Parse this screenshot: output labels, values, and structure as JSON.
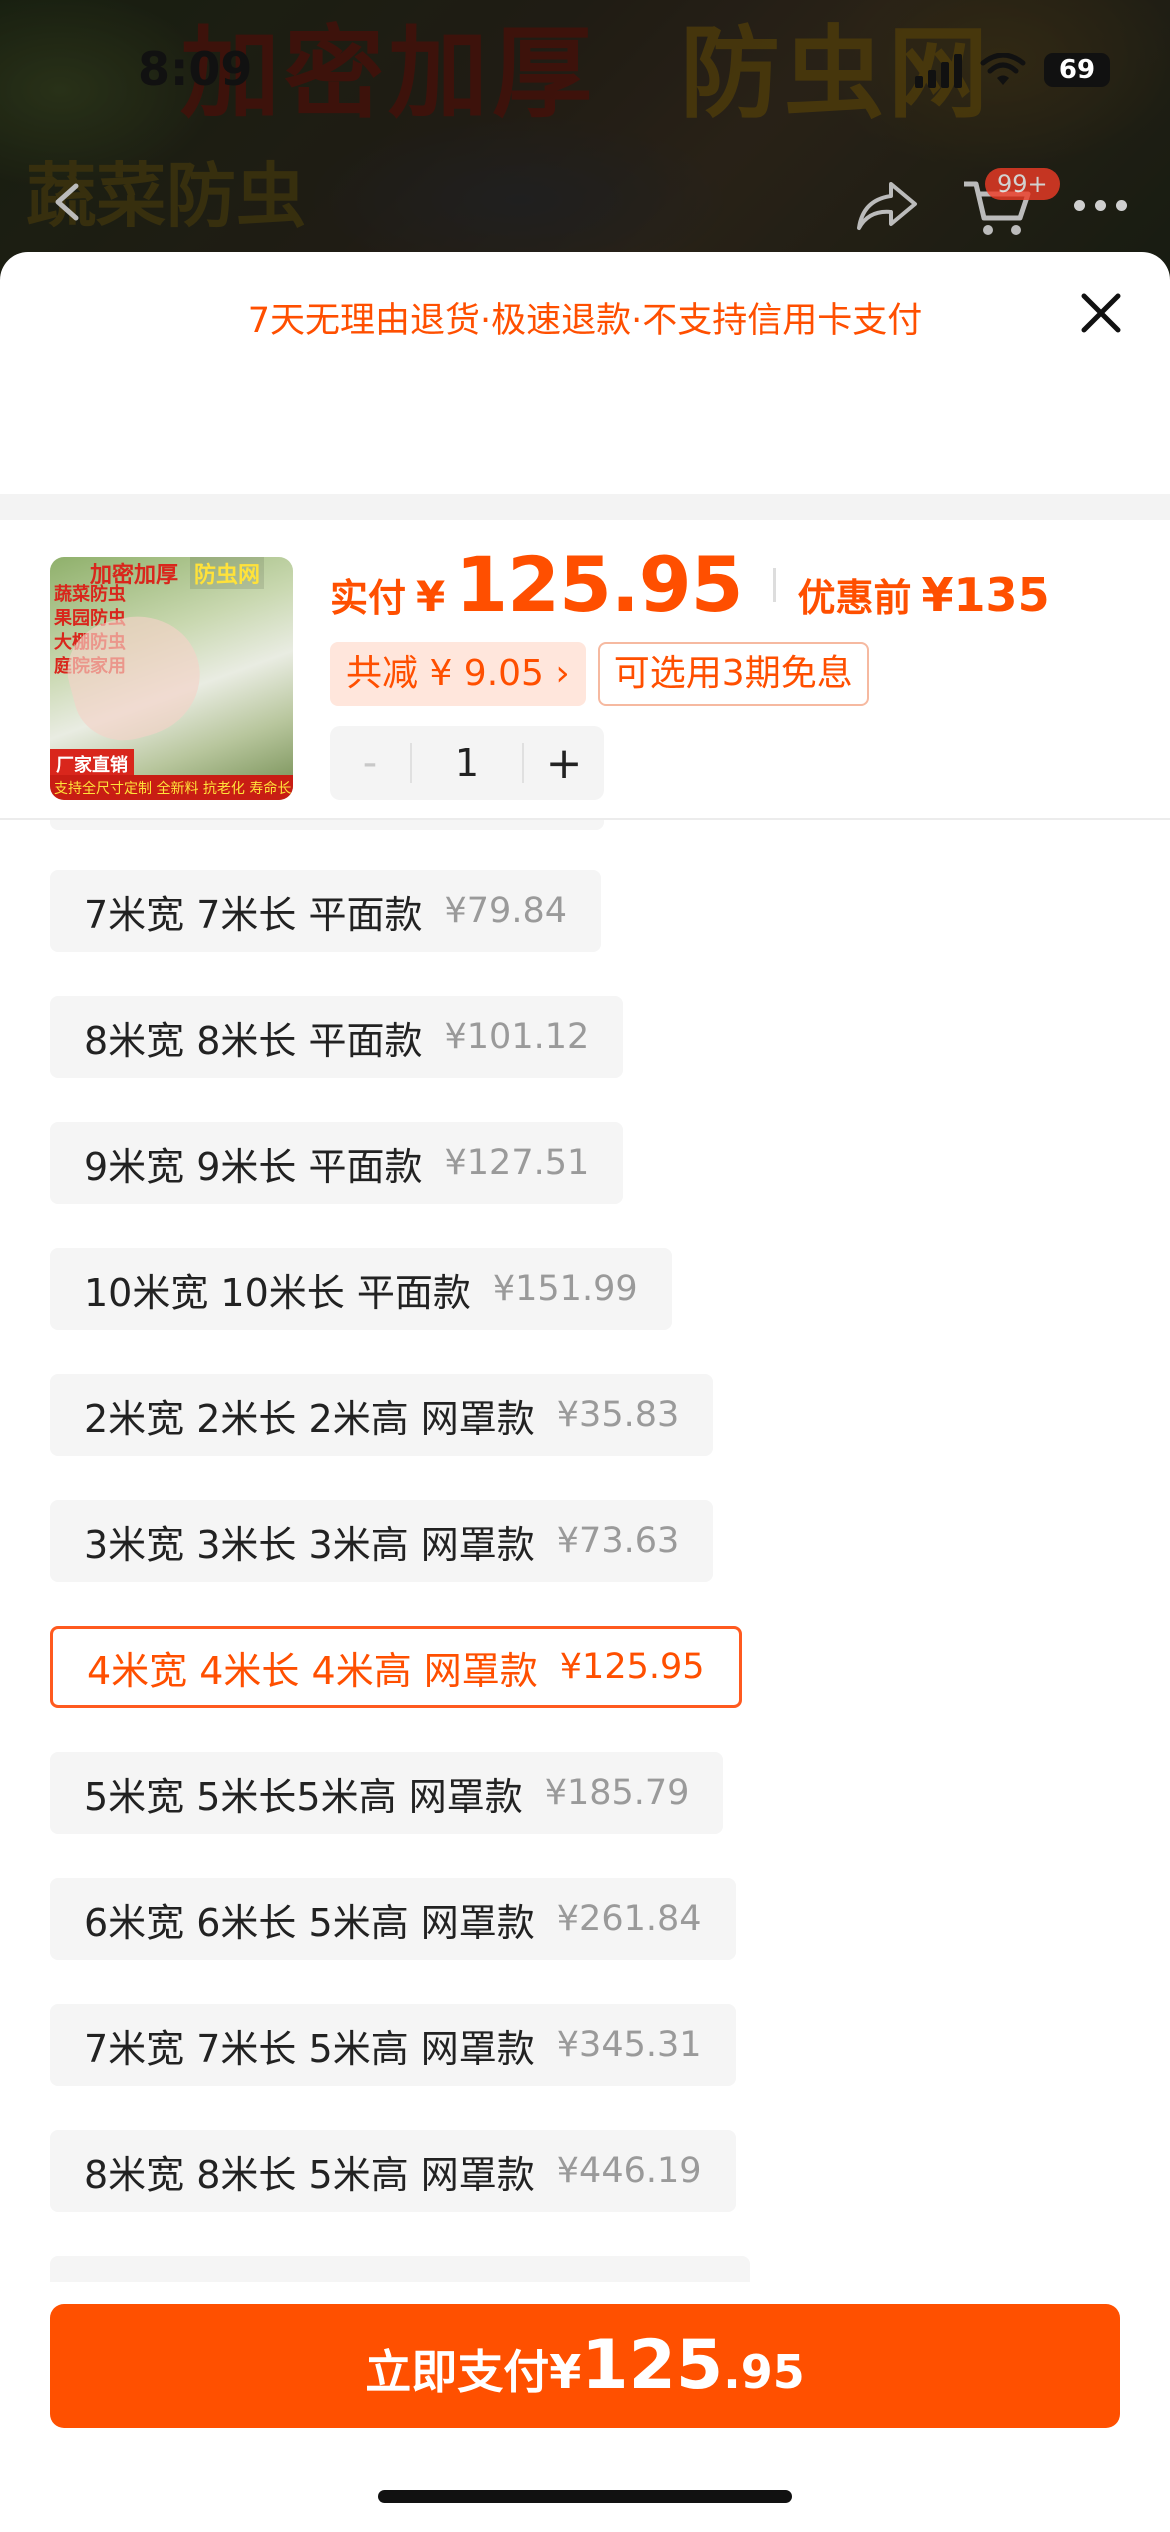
{
  "status_bar": {
    "time": "8:09",
    "battery": "69"
  },
  "background_page": {
    "banner_left": "加密加厚",
    "banner_right": "防虫网",
    "banner_sub": "蔬菜防虫",
    "cart_badge": "99+"
  },
  "sheet": {
    "notice": "7天无理由退货·极速退款·不支持信用卡支付"
  },
  "product_thumb": {
    "top_left": "加密加厚",
    "top_right": "防虫网",
    "lines": [
      "蔬菜防虫",
      "果园防虫",
      "大棚防虫",
      "庭院家用"
    ],
    "badge": "厂家直销",
    "footer": "支持全尺寸定制 全新料 抗老化 寿命长"
  },
  "summary": {
    "price_label": "实付",
    "currency": "¥",
    "price": "125.95",
    "original_label": "优惠前",
    "original_price": "¥135",
    "discount_tag": "共减 ¥ 9.05 ›",
    "installment_tag": "可选用3期免息",
    "quantity": "1",
    "minus": "-",
    "plus": "+"
  },
  "options": [
    {
      "label": "7米宽 7米长 平面款",
      "price": "¥79.84",
      "selected": false
    },
    {
      "label": "8米宽 8米长 平面款",
      "price": "¥101.12",
      "selected": false
    },
    {
      "label": "9米宽 9米长 平面款",
      "price": "¥127.51",
      "selected": false
    },
    {
      "label": "10米宽 10米长 平面款",
      "price": "¥151.99",
      "selected": false
    },
    {
      "label": "2米宽 2米长 2米高 网罩款",
      "price": "¥35.83",
      "selected": false
    },
    {
      "label": "3米宽 3米长 3米高 网罩款",
      "price": "¥73.63",
      "selected": false
    },
    {
      "label": "4米宽 4米长 4米高 网罩款",
      "price": "¥125.95",
      "selected": true
    },
    {
      "label": "5米宽 5米长5米高 网罩款",
      "price": "¥185.79",
      "selected": false
    },
    {
      "label": "6米宽 6米长 5米高 网罩款",
      "price": "¥261.84",
      "selected": false
    },
    {
      "label": "7米宽 7米长 5米高 网罩款",
      "price": "¥345.31",
      "selected": false
    },
    {
      "label": "8米宽 8米长 5米高 网罩款",
      "price": "¥446.19",
      "selected": false
    }
  ],
  "pay_button": {
    "label": "立即支付¥",
    "amount_int": "125",
    "amount_dec": ".95"
  },
  "colors": {
    "accent": "#ff5000",
    "accent_text": "#ff4f00",
    "option_bg": "#f5f5f5"
  }
}
